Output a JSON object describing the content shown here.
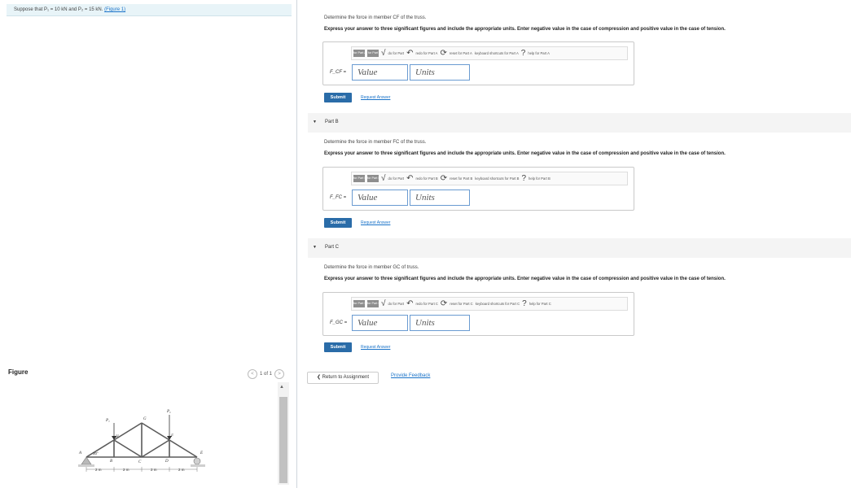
{
  "intro": {
    "text": "Suppose that P₁ = 10 kN and P₂ = 15 kN.",
    "figure_link": "(Figure 1)"
  },
  "figure": {
    "label": "Figure",
    "pager": {
      "prev": "<",
      "count": "1 of 1",
      "next": ">"
    },
    "scroll_up": "▲",
    "nodes": [
      "A",
      "H",
      "G",
      "F",
      "E",
      "B",
      "C",
      "D"
    ],
    "loads": [
      "P₁",
      "P₂"
    ],
    "angle": "30°",
    "dims": [
      "2 m",
      "2 m",
      "2 m",
      "2 m"
    ]
  },
  "parts": [
    {
      "header": "",
      "question": "Determine the force in member CF of the truss.",
      "instruction": "Express your answer to three significant figures and include the appropriate units. Enter negative value in the case of compression and positive value in the case of tension.",
      "toolbar": {
        "t1": "for Part A",
        "t2": "for Part",
        "undo": "do for Part",
        "redo": "redo for Part A",
        "reset": "reset for Part A",
        "kbd": "keyboard shortcuts for Part A",
        "help": "help for Part A"
      },
      "label": "F_CF =",
      "value_placeholder": "Value",
      "units_placeholder": "Units",
      "submit": "Submit",
      "request": "Request Answer"
    },
    {
      "header": "Part B",
      "question": "Determine the force in member FC of the truss.",
      "instruction": "Express your answer to three significant figures and include the appropriate units. Enter negative value in the case of compression and positive value in the case of tension.",
      "toolbar": {
        "t1": "for Part B",
        "t2": "for Part B",
        "undo": "do for Part",
        "redo": "redo for Part B",
        "reset": "reset for Part B",
        "kbd": "keyboard shortcuts for Part B",
        "help": "help for Part B"
      },
      "label": "F_FC =",
      "value_placeholder": "Value",
      "units_placeholder": "Units",
      "submit": "Submit",
      "request": "Request Answer"
    },
    {
      "header": "Part C",
      "question": "Determine the force in member GC of truss.",
      "instruction": "Express your answer to three significant figures and include the appropriate units. Enter negative value in the case of compression and positive value in the case of tension.",
      "toolbar": {
        "t1": "for Part C",
        "t2": "for Part C",
        "undo": "do for Part",
        "redo": "redo for Part C",
        "reset": "reset for Part C",
        "kbd": "keyboard shortcuts for Part C",
        "help": "help for Part C"
      },
      "label": "F_GC =",
      "value_placeholder": "Value",
      "units_placeholder": "Units",
      "submit": "Submit",
      "request": "Request Answer"
    }
  ],
  "footer": {
    "return": "❮ Return to Assignment",
    "feedback": "Provide Feedback"
  },
  "colors": {
    "accent": "#2a6ca8",
    "link": "#1a73c9",
    "input_border": "#6a9bd1"
  }
}
